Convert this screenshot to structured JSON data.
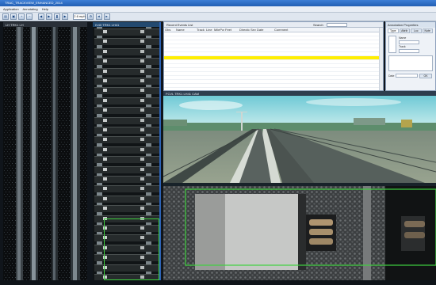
{
  "window": {
    "title": "TRAC_TRACKVIEW_ENHANCED_2014"
  },
  "menu": [
    "Application",
    "Annotating",
    "Help"
  ],
  "toolbar": {
    "speed_value": "2.6 mph",
    "icons": [
      "open-icon",
      "save-icon",
      "zoom-in-icon",
      "zoom-out-icon",
      "play-icon",
      "pause-icon",
      "rewind-icon",
      "forward-icon"
    ]
  },
  "left_panel": {
    "header": "LH  TRK1 LH"
  },
  "mid_panel": {
    "header": "IV40  TRK1 LH41"
  },
  "table": {
    "title": "Recent Events List",
    "search_label": "Search",
    "columns": [
      "Obs",
      "Name",
      "Track",
      "Line",
      "MilePost",
      "Feet",
      "Direction",
      "Severity",
      "Date",
      "Comment"
    ],
    "selected_row": 6,
    "rows": [
      [
        "",
        "",
        "",
        "",
        "",
        "",
        "",
        "",
        "",
        ""
      ],
      [
        "",
        "",
        "",
        "",
        "",
        "",
        "",
        "",
        "",
        ""
      ],
      [
        "",
        "",
        "",
        "",
        "",
        "",
        "",
        "",
        "",
        ""
      ],
      [
        "",
        "",
        "",
        "",
        "",
        "",
        "",
        "",
        "",
        ""
      ],
      [
        "",
        "",
        "",
        "",
        "",
        "",
        "",
        "",
        "",
        ""
      ],
      [
        "",
        "",
        "",
        "",
        "",
        "",
        "",
        "",
        "",
        ""
      ],
      [
        "",
        "",
        "",
        "",
        "",
        "",
        "",
        "",
        "",
        ""
      ],
      [
        "",
        "",
        "",
        "",
        "",
        "",
        "",
        "",
        "",
        ""
      ],
      [
        "",
        "",
        "",
        "",
        "",
        "",
        "",
        "",
        "",
        ""
      ],
      [
        "",
        "",
        "",
        "",
        "",
        "",
        "",
        "",
        "",
        ""
      ],
      [
        "",
        "",
        "",
        "",
        "",
        "",
        "",
        "",
        "",
        ""
      ],
      [
        "",
        "",
        "",
        "",
        "",
        "",
        "",
        "",
        "",
        ""
      ],
      [
        "",
        "",
        "",
        "",
        "",
        "",
        "",
        "",
        "",
        ""
      ],
      [
        "",
        "",
        "",
        "",
        "",
        "",
        "",
        "",
        "",
        ""
      ]
    ]
  },
  "form": {
    "title": "Annotation Properties",
    "tabs": [
      "Type",
      "Attrib",
      "Loc",
      "Note"
    ],
    "fields": [
      "Name",
      "Track",
      "Date"
    ],
    "button": "OK"
  },
  "camera": {
    "header": "FCVL   TRK1 LH41 CAM",
    "sky_color": "#9cd8e2",
    "ground_color": "#8a9a84"
  },
  "colors": {
    "accent": "#2c62b5",
    "selection": "#ffee00",
    "overlay_green": "#3fd13f"
  }
}
